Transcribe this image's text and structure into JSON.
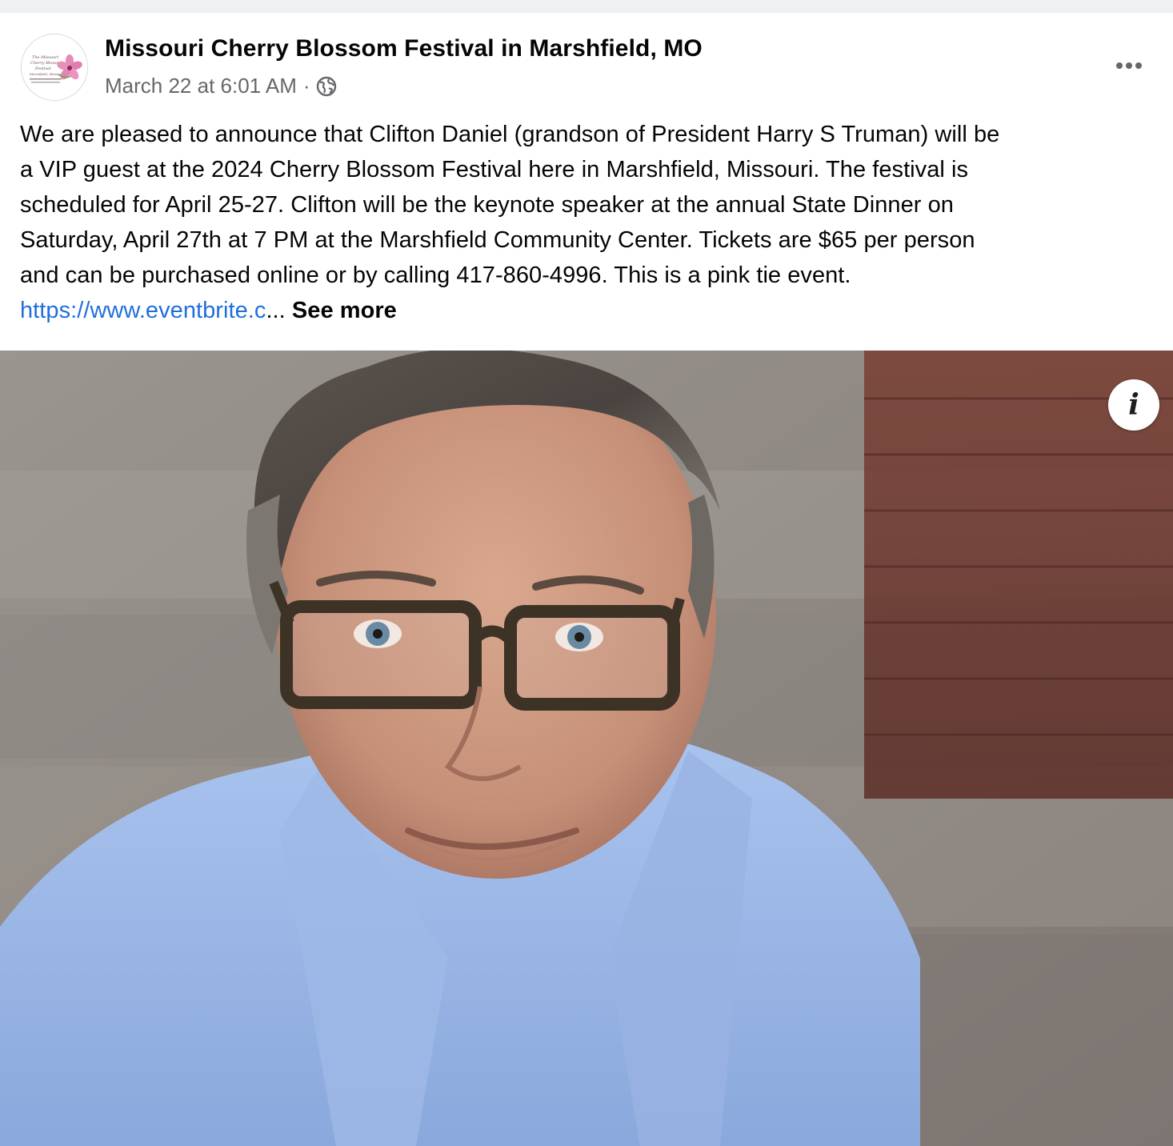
{
  "post": {
    "page_name": "Missouri Cherry Blossom Festival in Marshfield, MO",
    "timestamp": "March 22 at 6:01 AM",
    "separator": "·",
    "privacy_icon": "globe-icon",
    "more_icon": "more-options-icon",
    "avatar": {
      "logo_text": [
        "The Missouri",
        "Cherry Blossom",
        "Festival",
        "Marshfield, Missouri"
      ]
    },
    "body_lines": [
      "We are pleased to announce that Clifton Daniel (grandson of President Harry S Truman) will be",
      "a VIP guest at the 2024 Cherry Blossom Festival here in Marshfield, Missouri. The festival is",
      "scheduled for April 25-27. Clifton will be the keynote speaker at the annual State Dinner on",
      "Saturday, April 27th at 7 PM at the Marshfield Community Center.  Tickets are $65 per person",
      "and can be purchased online or by calling 417-860-4996. This is a pink tie event."
    ],
    "link_text": "https://www.eventbrite.c",
    "ellipsis": "...",
    "see_more": "See more",
    "info_icon_glyph": "i"
  },
  "colors": {
    "text_primary": "#050505",
    "text_secondary": "#65676b",
    "link": "#216fdb",
    "background": "#ffffff"
  }
}
